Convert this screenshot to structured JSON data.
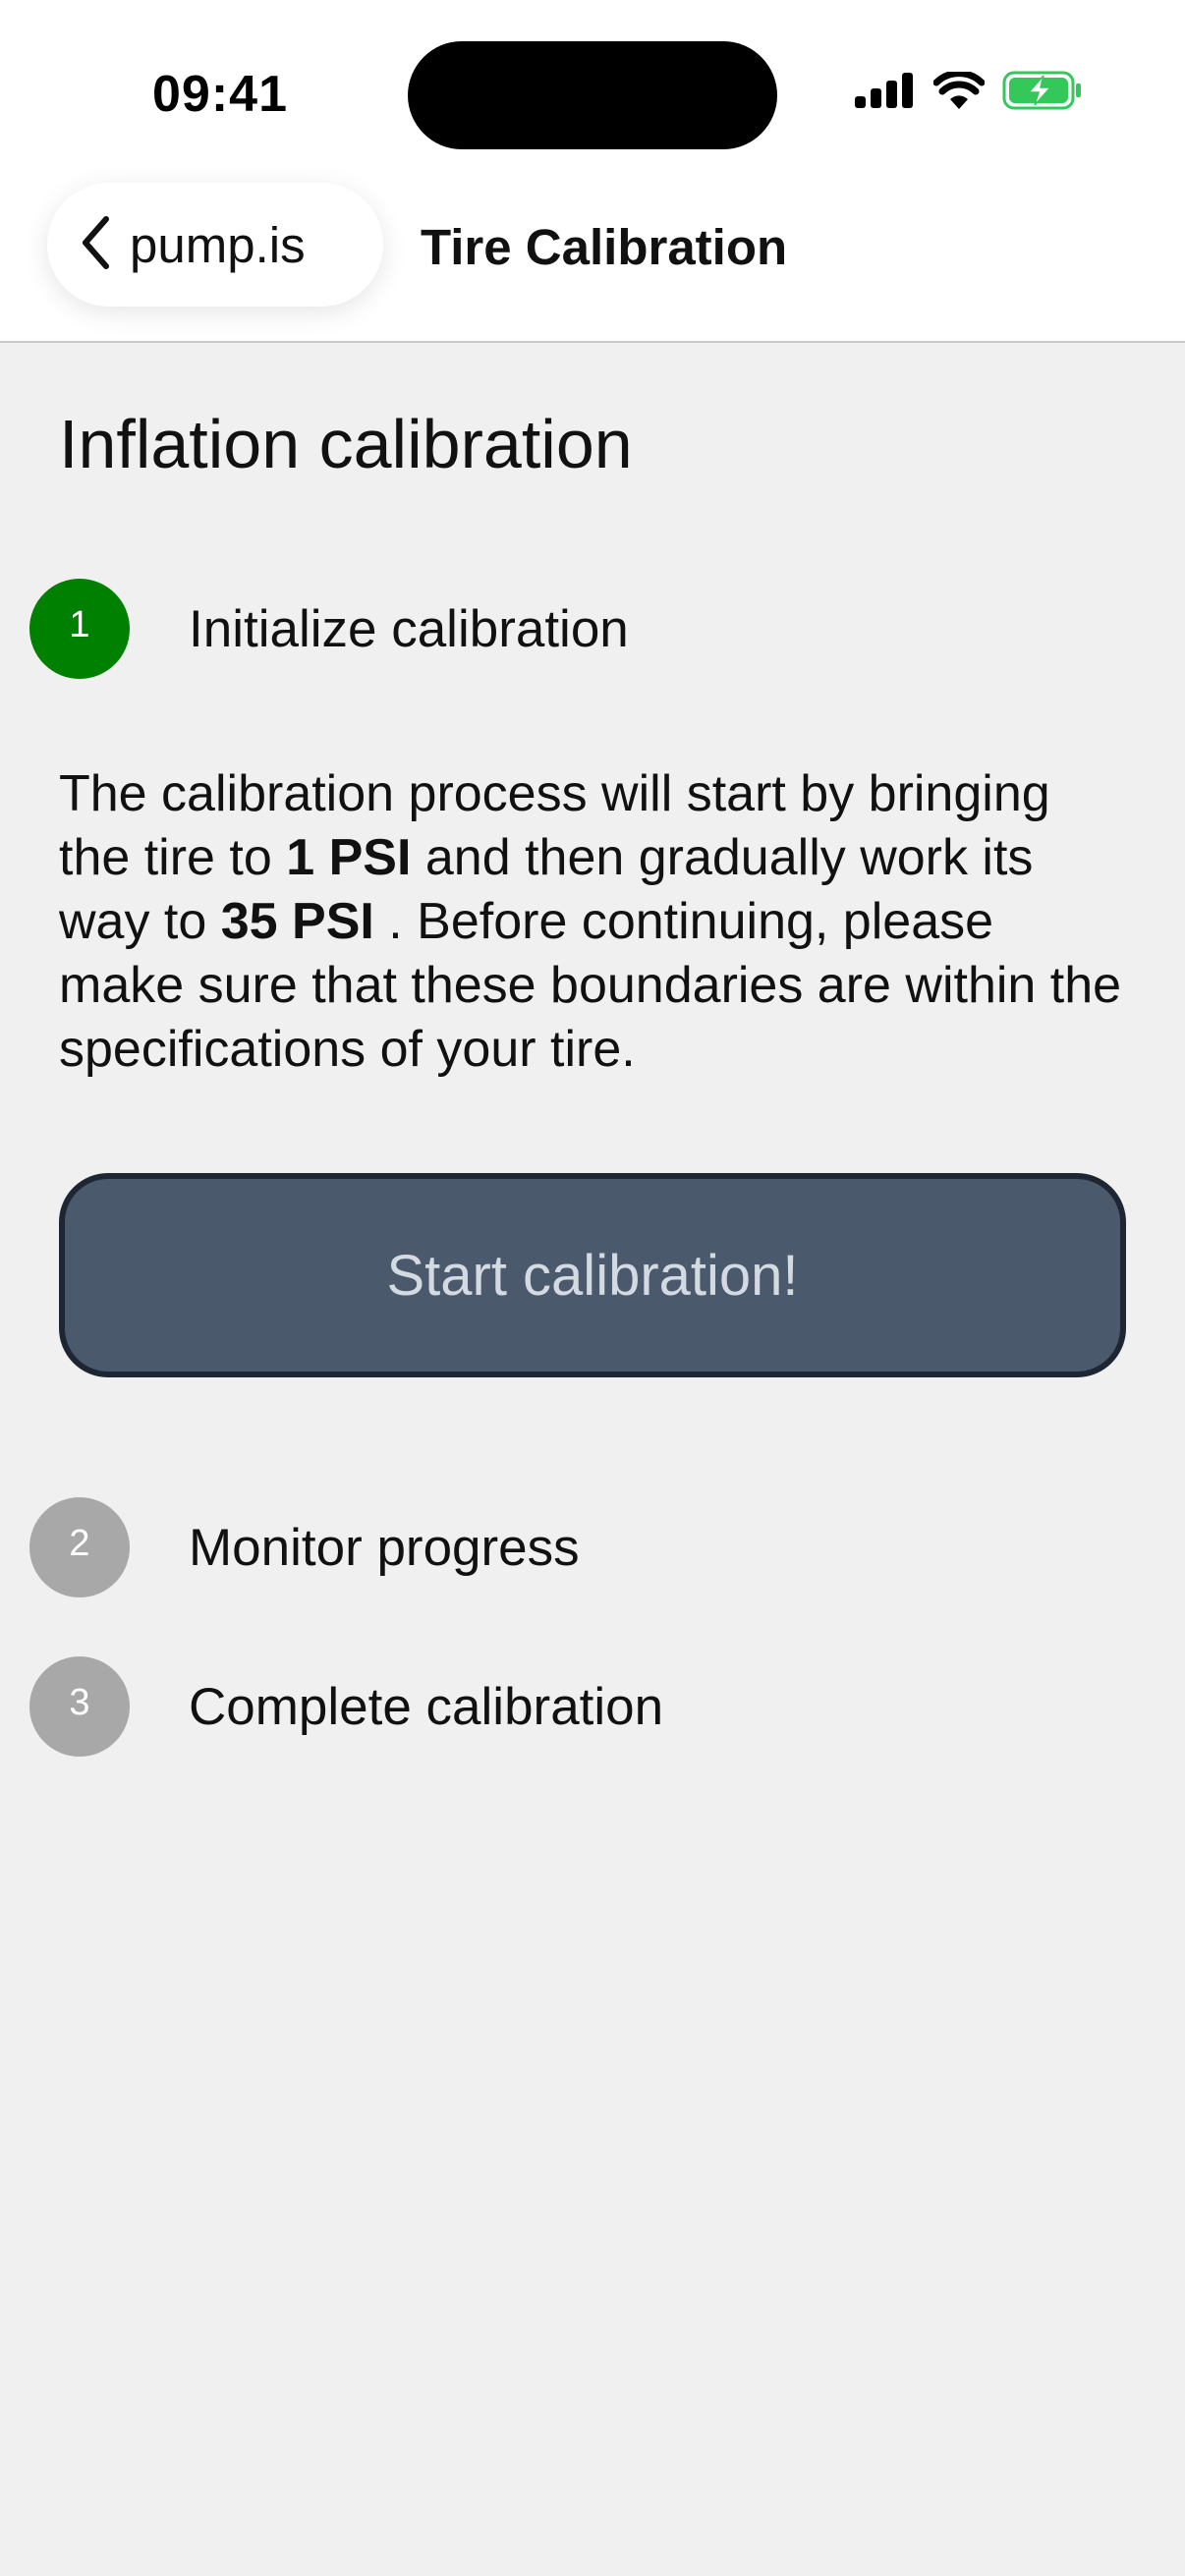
{
  "status_bar": {
    "time": "09:41"
  },
  "nav": {
    "back_label": "pump.is",
    "title": "Tire Calibration"
  },
  "page": {
    "title": "Inflation calibration"
  },
  "steps": [
    {
      "number": "1",
      "label": "Initialize calibration",
      "state": "active",
      "color": "#008000"
    },
    {
      "number": "2",
      "label": "Monitor progress",
      "state": "pending",
      "color": "#a8a8a8"
    },
    {
      "number": "3",
      "label": "Complete calibration",
      "state": "pending",
      "color": "#a8a8a8"
    }
  ],
  "description": {
    "part1": "The calibration process will start by bringing the tire to ",
    "min_pressure": "1 PSI",
    "part2": " and then gradually work its way to ",
    "max_pressure": "35 PSI",
    "part3": " . Before continuing, please make sure that these boundaries are within the specifications of your tire."
  },
  "start_button": {
    "label": "Start calibration!"
  },
  "colors": {
    "step_active": "#008000",
    "step_pending": "#a8a8a8",
    "button_bg": "#4a596c",
    "button_border": "#1e2633",
    "battery": "#34c759"
  }
}
